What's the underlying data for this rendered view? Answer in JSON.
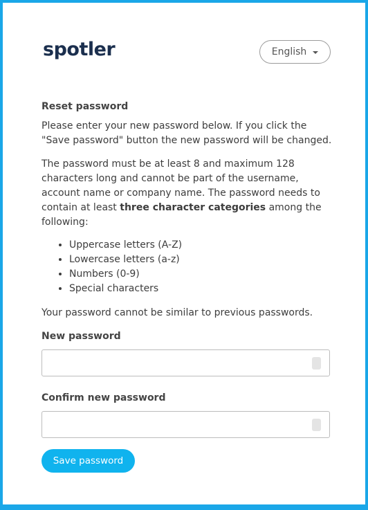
{
  "brand": {
    "logo_text": "spotler"
  },
  "language": {
    "selected": "English"
  },
  "form": {
    "heading": "Reset password",
    "intro": "Please enter your new password below. If you click the \"Save password\" button the new password will be changed.",
    "rules_text_before": "The password must be at least 8 and maximum 128 characters long and cannot be part of the username, account name or company name. The password needs to contain at least ",
    "rules_text_bold": "three character categories",
    "rules_text_after": " among the following:",
    "categories": [
      "Uppercase letters (A-Z)",
      "Lowercase letters (a-z)",
      "Numbers (0-9)",
      "Special characters"
    ],
    "history_note": "Your password cannot be similar to previous passwords.",
    "new_password_label": "New password",
    "new_password_value": "",
    "confirm_password_label": "Confirm new password",
    "confirm_password_value": "",
    "save_label": "Save password"
  },
  "colors": {
    "border": "#1aa7e8",
    "button": "#10b3ee",
    "logo": "#1b2f4e"
  }
}
